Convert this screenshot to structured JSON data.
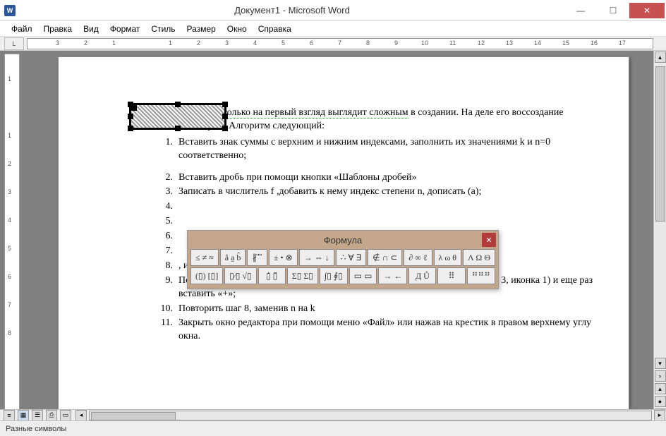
{
  "window": {
    "title": "Документ1 - Microsoft Word",
    "app_icon_text": "W"
  },
  "menu": {
    "items": [
      "Файл",
      "Правка",
      "Вид",
      "Формат",
      "Стиль",
      "Размер",
      "Окно",
      "Справка"
    ]
  },
  "ruler": {
    "horizontal_labels": [
      "3",
      "2",
      "1",
      "1",
      "2",
      "3",
      "4",
      "5",
      "6",
      "7",
      "8",
      "9",
      "10",
      "11",
      "12",
      "13",
      "14",
      "15",
      "16",
      "17"
    ],
    "vertical_labels": [
      "1",
      "1",
      "2",
      "3",
      "4",
      "5",
      "6",
      "7",
      "8"
    ]
  },
  "document": {
    "intro_part1": "Ряд Тейлора только на первый взгляд выглядит сложным",
    "intro_part2": " в создании. На деле его воссоздание занимает 2-3 минуты. Алгоритм следующий:",
    "items": [
      "Вставить знак суммы с верхним и нижним индексами, заполнить их значениями k и n=0 соответственно;",
      "Вставить дробь при помощи кнопки «Шаблоны дробей»",
      "Записать в числитель f ,добавить к нему индекс степени n, дописать (a);",
      "",
      "",
      "",
      "",
      ", и заменить n числом 2;",
      "Поставить «+», добавить многоточие (кнопка «Пробелы и многоточия», ряд 3, иконка 1) и еще раз вставить «+»;",
      "Повторить шаг 8, заменив n на k",
      "Закрыть окно редактора при помощи меню «Файл» или нажав на крестик в правом верхнему углу окна."
    ]
  },
  "formula_window": {
    "title": "Формула",
    "row1": [
      "≤ ≠ ≈",
      "å a̱ b̂",
      "∦ ⃗ ⃡",
      "± • ⊗",
      "→ ⇔ ↓",
      "∴ ∀ ∃",
      "∉ ∩ ⊂",
      "∂ ∞ ℓ",
      "λ ω θ",
      "Λ Ω Θ"
    ],
    "row2": [
      "(▯) [▯]",
      "▯⁄▯ √▯",
      "▯̇ ▯̈",
      "Σ▯ Σ▯",
      "∫▯ ∮▯",
      "▭ ▭",
      "→ ←",
      "Д Ů",
      "⠿",
      "⠛⠛⠛"
    ]
  },
  "statusbar": {
    "text": "Разные символы"
  }
}
